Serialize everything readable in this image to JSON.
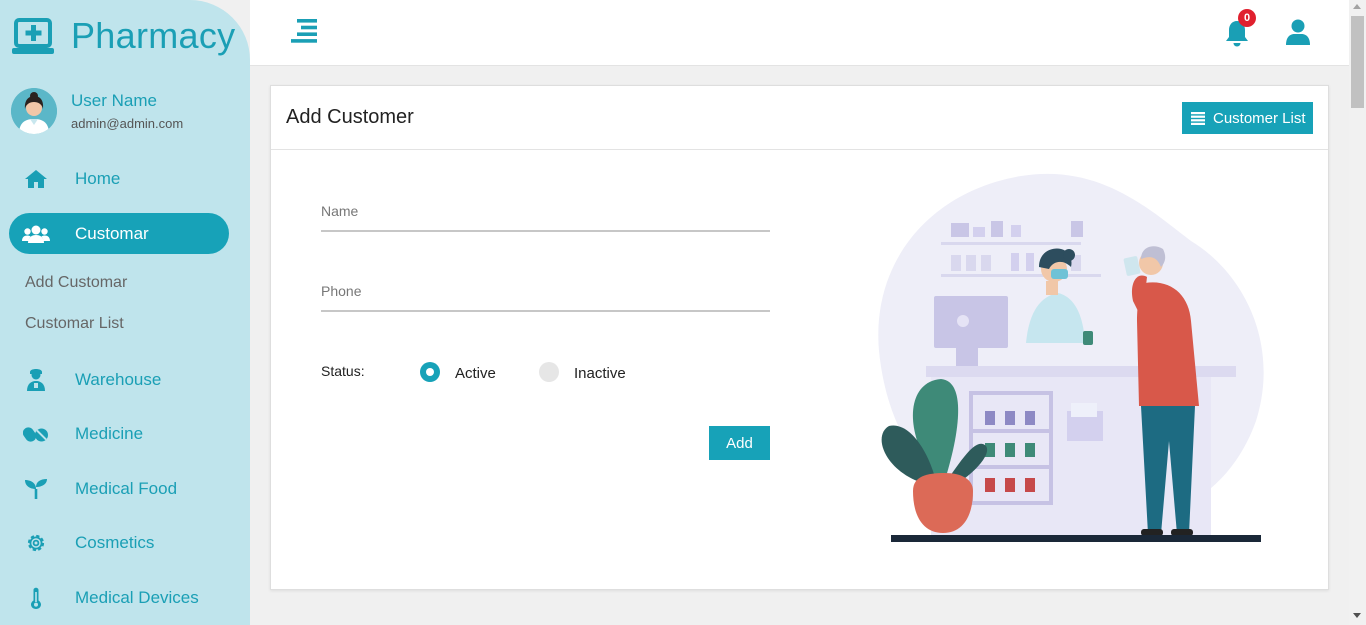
{
  "brand": {
    "name": "Pharmacy",
    "icon": "monitor-plus-icon"
  },
  "user": {
    "name": "User Name",
    "email": "admin@admin.com"
  },
  "nav": {
    "home": "Home",
    "customer": "Customar",
    "add_customer": "Add Customar",
    "customer_list": "Customar List",
    "warehouse": "Warehouse",
    "medicine": "Medicine",
    "medical_food": "Medical Food",
    "cosmetics": "Cosmetics",
    "medical_devices": "Medical Devices"
  },
  "topbar": {
    "notification_count": "0"
  },
  "card": {
    "title": "Add Customer",
    "list_button": "Customer List"
  },
  "form": {
    "name_placeholder": "Name",
    "phone_placeholder": "Phone",
    "status_label": "Status:",
    "status_options": [
      "Active",
      "Inactive"
    ],
    "status_selected": "Active",
    "submit_label": "Add"
  },
  "colors": {
    "accent": "#17a2b8",
    "sidebar_bg": "#bfe4ec",
    "badge": "#e0202e"
  }
}
